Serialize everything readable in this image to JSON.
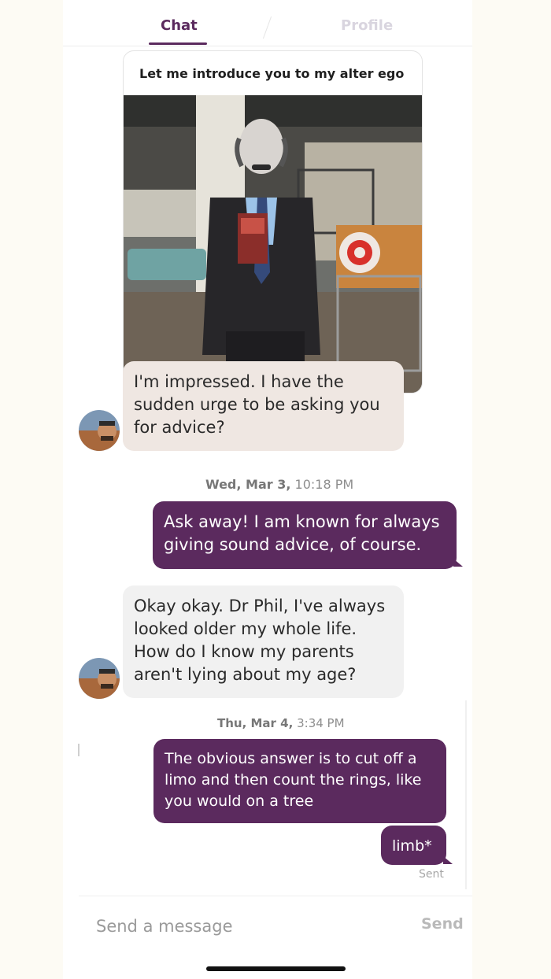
{
  "tabs": {
    "chat": "Chat",
    "profile": "Profile"
  },
  "photo_message": {
    "caption": "Let me introduce you to my alter ego"
  },
  "messages": [
    {
      "text": "I'm impressed. I have the sudden urge to be asking you for advice?"
    },
    {
      "text": "Ask away! I am known for always giving sound advice, of course."
    },
    {
      "text": "Okay okay. Dr Phil, I've always looked older my whole life. How do I know my parents aren't lying about my age?"
    },
    {
      "text": "The obvious answer is to cut off a limo and then count the rings, like you would on a tree"
    },
    {
      "text": "limb*"
    }
  ],
  "timestamps": [
    {
      "day": "Wed, Mar 3,",
      "time": "10:18 PM"
    },
    {
      "day": "Thu, Mar 4,",
      "time": "3:34 PM"
    }
  ],
  "status": {
    "sent": "Sent"
  },
  "composer": {
    "placeholder": "Send a message",
    "send_label": "Send"
  },
  "colors": {
    "accent": "#5b2a5e",
    "incoming_tan": "#efe7e2",
    "incoming_gray": "#f1f1f1"
  },
  "icons": [
    "avatar",
    "home-indicator"
  ]
}
